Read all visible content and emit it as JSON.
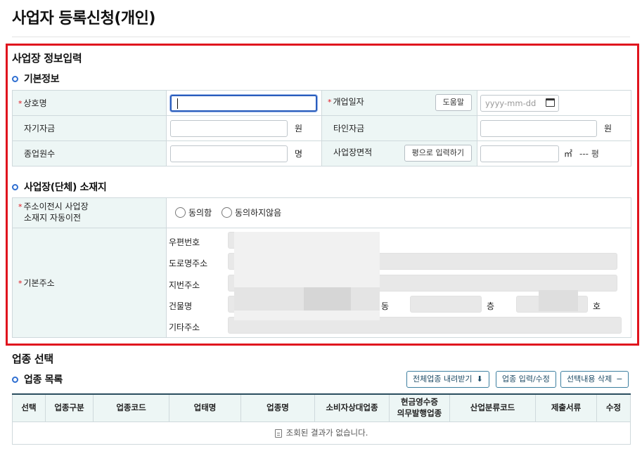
{
  "page": {
    "title": "사업자 등록신청(개인)"
  },
  "business_info": {
    "section_title": "사업장 정보입력",
    "basic": {
      "title": "기본정보",
      "trade_name_label": "상호명",
      "trade_name_value": "",
      "opening_date_label": "개업일자",
      "help_button": "도움말",
      "date_placeholder": "yyyy-mm-dd",
      "own_capital_label": "자기자금",
      "other_capital_label": "타인자금",
      "currency_unit": "원",
      "employees_label": "종업원수",
      "employees_unit": "명",
      "area_label": "사업장면적",
      "pyeong_button": "평으로 입력하기",
      "area_unit": "㎡",
      "pyeong_readout": "--- 평"
    },
    "location": {
      "title": "사업장(단체) 소재지",
      "auto_move_label_line1": "주소이전시 사업장",
      "auto_move_label_line2": "소재지 자동이전",
      "radio_agree": "동의함",
      "radio_disagree": "동의하지않음",
      "address_label": "기본주소",
      "postal_label": "우편번호",
      "road_label": "도로명주소",
      "lot_label": "지번주소",
      "building_label": "건물명",
      "dong_unit": "동",
      "floor_unit": "층",
      "ho_unit": "호",
      "other_label": "기타주소"
    }
  },
  "industry": {
    "section_title": "업종 선택",
    "list_title": "업종 목록",
    "buttons": {
      "download_all": "전체업종 내려받기",
      "enter_edit": "업종 입력/수정",
      "delete_selected": "선택내용 삭제"
    },
    "columns": [
      "선택",
      "업종구분",
      "업종코드",
      "업태명",
      "업종명",
      "소비자상대업종",
      "현금영수증\n의무발행업종",
      "산업분류코드",
      "제출서류",
      "수정"
    ],
    "empty_message": "조회된 결과가 없습니다."
  }
}
